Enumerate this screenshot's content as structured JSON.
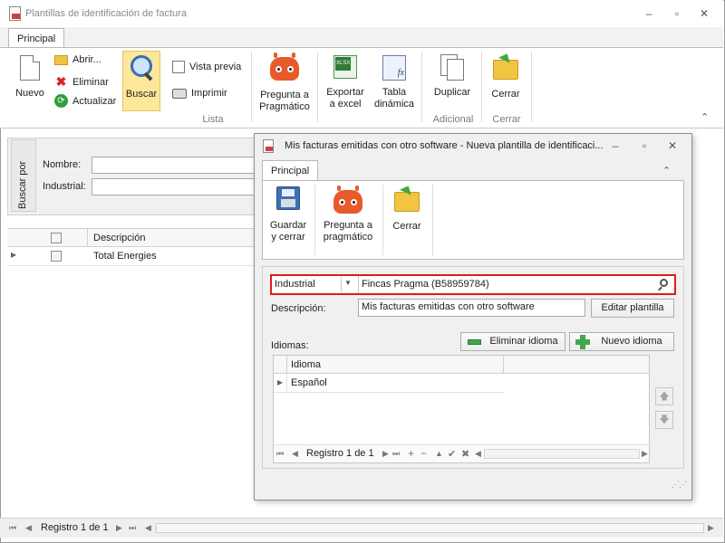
{
  "window": {
    "title": "Plantillas de identificación de factura",
    "controls": {
      "minimize": "–",
      "maximize": "▫",
      "close": "✕"
    }
  },
  "ribbon": {
    "tab": "Principal",
    "nuevo": "Nuevo",
    "abrir": "Abrir...",
    "eliminar": "Eliminar",
    "actualizar": "Actualizar",
    "buscar": "Buscar",
    "vista_previa": "Vista previa",
    "imprimir": "Imprimir",
    "pregunta_line1": "Pregunta a",
    "pregunta_line2": "Pragmático",
    "exportar_line1": "Exportar",
    "exportar_line2": "a excel",
    "tabla_line1": "Tabla",
    "tabla_line2": "dinámica",
    "duplicar": "Duplicar",
    "cerrar": "Cerrar",
    "group_lista": "Lista",
    "group_adicional": "Adicional",
    "group_cerrar": "Cerrar",
    "collapse": "⌃"
  },
  "search_panel": {
    "vertical_label": "Buscar por",
    "nombre_label": "Nombre:",
    "nombre_value": "",
    "industrial_label": "Industrial:",
    "industrial_value": ""
  },
  "grid": {
    "header_description": "Descripción",
    "rows": [
      {
        "description": "Total Energies"
      }
    ]
  },
  "statusbar": {
    "record_text": "Registro 1 de 1"
  },
  "dialog": {
    "title": "Mis facturas emitidas con otro software - Nueva plantilla de identificaci...",
    "tab": "Principal",
    "guardar_line1": "Guardar",
    "guardar_line2": "y cerrar",
    "pregunta_line1": "Pregunta a",
    "pregunta_line2": "pragmático",
    "cerrar": "Cerrar",
    "collapse": "⌃",
    "industrial_dropdown": "Industrial",
    "industrial_value": "Fincas Pragma (B58959784)",
    "descripcion_label": "Descripción:",
    "descripcion_value": "Mis facturas emitidas con otro software",
    "editar_plantilla": "Editar plantilla",
    "idiomas_label": "Idiomas:",
    "eliminar_idioma": "Eliminar idioma",
    "nuevo_idioma": "Nuevo idioma",
    "idioma_header": "Idioma",
    "idiomas": [
      {
        "name": "Español"
      }
    ],
    "record_text": "Registro 1 de 1"
  }
}
